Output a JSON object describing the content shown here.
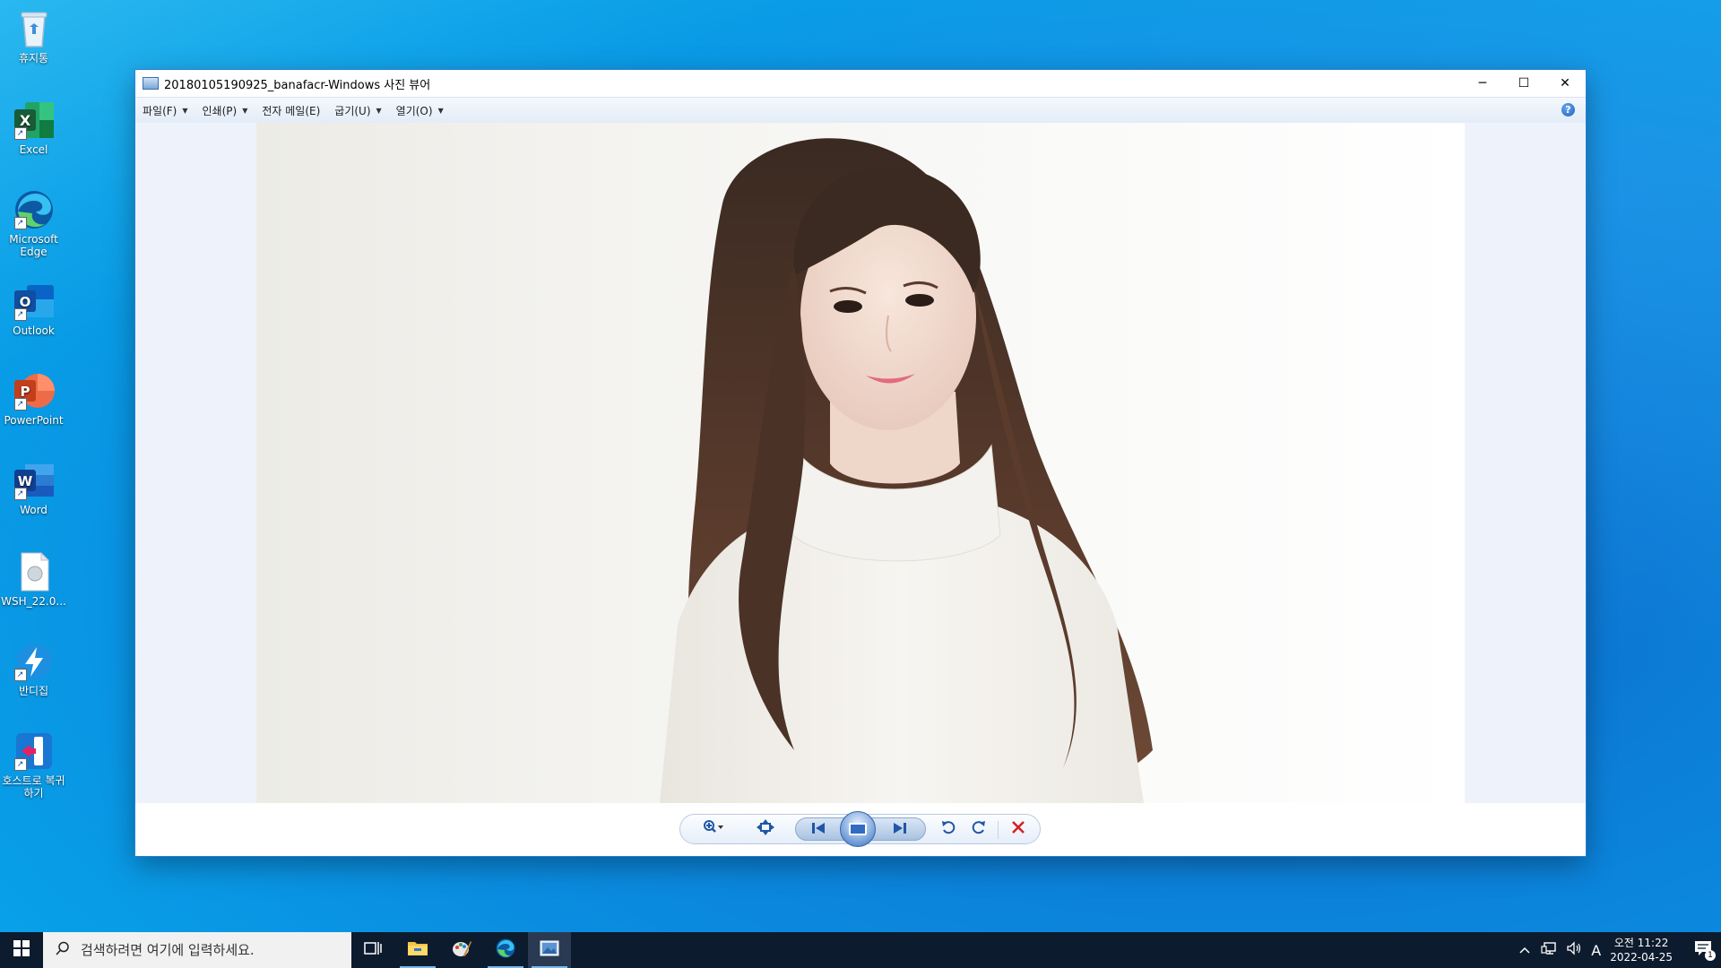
{
  "desktop": {
    "icons": [
      {
        "label": "휴지통",
        "icon": "recycle-bin-icon"
      },
      {
        "label": "Excel",
        "icon": "excel-icon"
      },
      {
        "label": "Microsoft Edge",
        "icon": "edge-icon"
      },
      {
        "label": "Outlook",
        "icon": "outlook-icon"
      },
      {
        "label": "PowerPoint",
        "icon": "powerpoint-icon"
      },
      {
        "label": "Word",
        "icon": "word-icon"
      },
      {
        "label": "WSH_22.0...",
        "icon": "file-icon"
      },
      {
        "label": "반디집",
        "icon": "bandizip-icon"
      },
      {
        "label": "호스트로 복귀하기",
        "icon": "host-return-icon"
      }
    ]
  },
  "window": {
    "title": "20180105190925_banafacr-Windows 사진 뷰어",
    "controls": {
      "minimize": "─",
      "maximize": "☐",
      "close": "✕"
    },
    "menu": [
      {
        "label": "파일(F)"
      },
      {
        "label": "인쇄(P)"
      },
      {
        "label": "전자 메일(E)"
      },
      {
        "label": "굽기(U)"
      },
      {
        "label": "열기(O)"
      }
    ],
    "help": "?"
  },
  "toolbar": {
    "zoom": "zoom-icon",
    "fit": "actual-size-icon",
    "prev": "previous-icon",
    "slideshow": "slideshow-icon",
    "next": "next-icon",
    "rotate_left": "rotate-counterclockwise-icon",
    "rotate_right": "rotate-clockwise-icon",
    "delete": "delete-icon"
  },
  "taskbar": {
    "search_placeholder": "검색하려면 여기에 입력하세요.",
    "tray": {
      "ime": "A"
    },
    "clock": {
      "time": "오전 11:22",
      "date": "2022-04-25"
    },
    "notifications": "1"
  },
  "colors": {
    "taskbar": "#0d1b2e",
    "accent": "#76b9ed",
    "delete_red": "#d42020"
  }
}
